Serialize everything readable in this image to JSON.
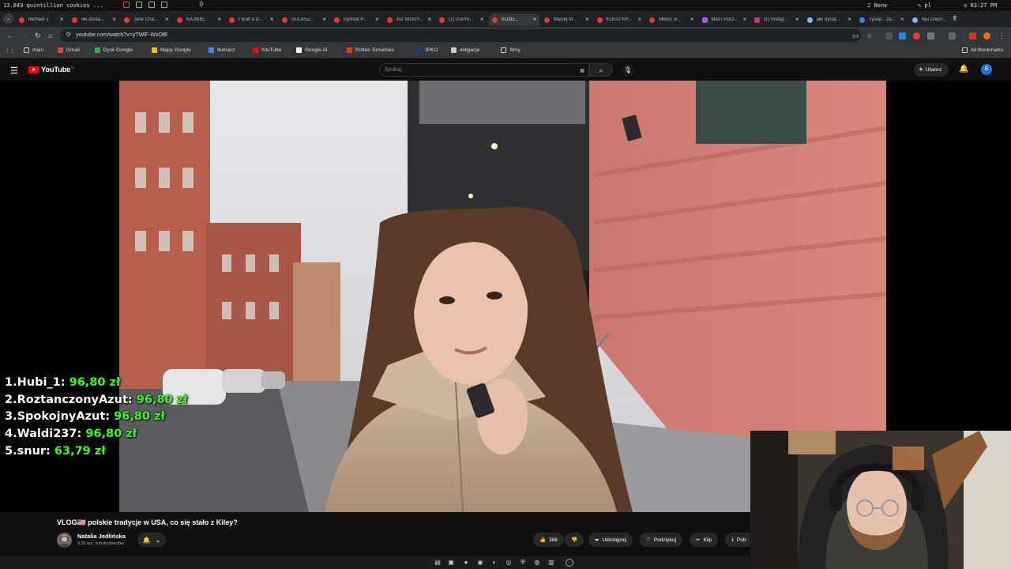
{
  "os_bar": {
    "left_text": "13.849 quintillion cookies ...",
    "right1": "None",
    "right2": "pl",
    "clock": "03:27 PM"
  },
  "tabs": [
    {
      "label": "Michael J.",
      "icon": "youtube-icon"
    },
    {
      "label": "nie dosta...",
      "icon": "youtube-icon"
    },
    {
      "label": "Jane Cha...",
      "icon": "youtube-icon"
    },
    {
      "label": "NAJWIĘ...",
      "icon": "youtube-icon"
    },
    {
      "label": "I Built a D...",
      "icon": "youtube-icon"
    },
    {
      "label": "GULASZ...",
      "icon": "youtube-icon"
    },
    {
      "label": "Gymrat P...",
      "icon": "youtube-icon"
    },
    {
      "label": "Już NIGDY...",
      "icon": "youtube-icon"
    },
    {
      "label": "(1) GoPro...",
      "icon": "youtube-icon"
    },
    {
      "label": "VLOG...",
      "icon": "youtube-icon",
      "active": true
    },
    {
      "label": "Maciej M...",
      "icon": "youtube-icon"
    },
    {
      "label": "KOGO KR...",
      "icon": "youtube-icon"
    },
    {
      "label": "Miłość w...",
      "icon": "youtube-icon"
    },
    {
      "label": "MaxTVGO...",
      "icon": "twitch-icon"
    },
    {
      "label": "(1) Instag...",
      "icon": "instagram-icon"
    },
    {
      "label": "jaki dysta...",
      "icon": "google-icon"
    },
    {
      "label": "Tysiąc - za...",
      "icon": "star-icon"
    },
    {
      "label": "nyu czesn...",
      "icon": "google-icon"
    }
  ],
  "address": {
    "url": "youtube.com/watch?v=yTWlF-WxOtE"
  },
  "bookmarks": [
    {
      "label": "main",
      "icon": "folder-icon"
    },
    {
      "label": "Gmail",
      "icon": "gmail-icon"
    },
    {
      "label": "Dysk Google",
      "icon": "drive-icon"
    },
    {
      "label": "Mapy Google",
      "icon": "maps-icon"
    },
    {
      "label": "tłumacz",
      "icon": "translate-icon"
    },
    {
      "label": "YouTube",
      "icon": "youtube-icon"
    },
    {
      "label": "Google AI",
      "icon": "ai-icon"
    },
    {
      "label": "Rotten Tomatoes",
      "icon": "tomato-icon"
    },
    {
      "label": "IPKO",
      "icon": "bank-icon"
    },
    {
      "label": "obligacje",
      "icon": "page-icon"
    },
    {
      "label": "filmy",
      "icon": "folder-icon"
    }
  ],
  "bookmarks_right": "All Bookmarks",
  "yt_header": {
    "logo_text": "YouTube",
    "country": "PL",
    "search_placeholder": "Szukaj",
    "create_label": "Utwórz",
    "avatar_letter": "B"
  },
  "leaderboard": [
    {
      "rank": "1.",
      "name": "Hubi_1:",
      "amount": "96,80 zł"
    },
    {
      "rank": "2.",
      "name": "RoztanczonyAzut:",
      "amount": "96,80 zł"
    },
    {
      "rank": "3.",
      "name": "SpokojnyAzut:",
      "amount": "96,80 zł"
    },
    {
      "rank": "4.",
      "name": "Waldi237:",
      "amount": "96,80 zł"
    },
    {
      "rank": "5.",
      "name": "snur:",
      "amount": "63,79 zł"
    }
  ],
  "video": {
    "title": "VLOG🇺🇸 polskie tradycje w USA, co się stało z Kiley?",
    "channel": "Natalia Jedlińska",
    "subscribers": "9,32 tys. subskrybentów",
    "likes": "388",
    "share_label": "Udostępnij",
    "thanks_label": "Podziękuj",
    "clip_label": "Klip",
    "download_label": "Pob"
  },
  "colors": {
    "accent": "#ff0000",
    "amount_green": "#39ff14",
    "avatar_blue": "#1a73e8"
  }
}
